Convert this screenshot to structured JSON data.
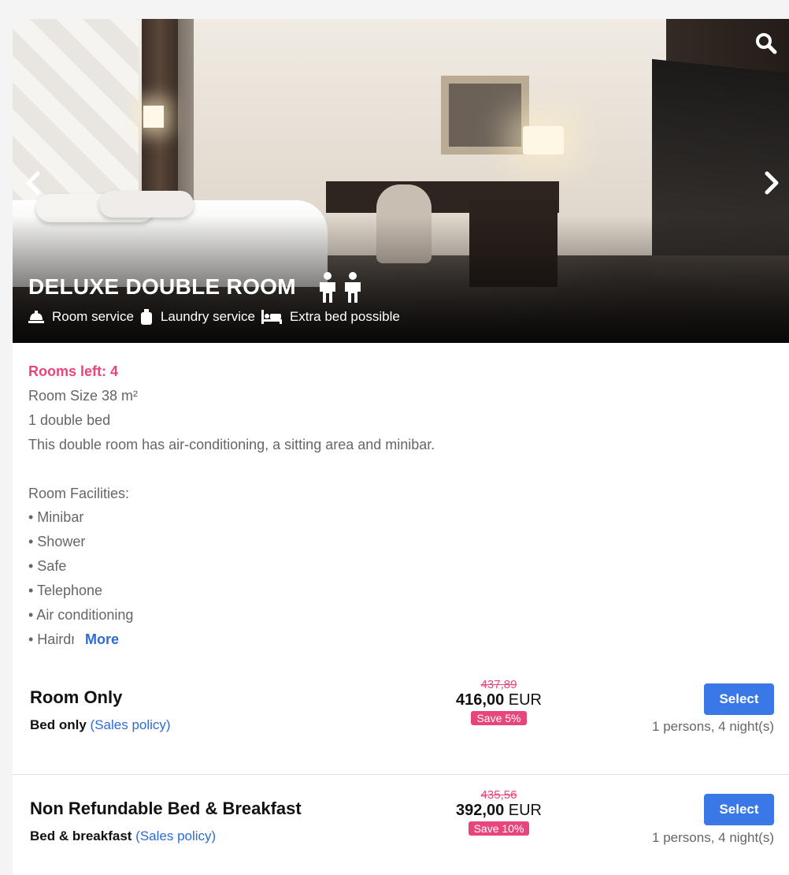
{
  "room": {
    "title": "DELUXE DOUBLE ROOM",
    "guest_icons": [
      "person-icon",
      "person-icon"
    ],
    "amenities": [
      {
        "icon": "bell-icon",
        "label": "Room service"
      },
      {
        "icon": "laundry-icon",
        "label": "Laundry service"
      },
      {
        "icon": "bed-icon",
        "label": "Extra bed possible"
      }
    ],
    "gallery_icons": {
      "search": "search-icon",
      "prev": "chevron-left-icon",
      "next": "chevron-right-icon"
    }
  },
  "details": {
    "rooms_left": "Rooms left: 4",
    "size": "Room Size 38 m²",
    "beds": "1 double bed",
    "description": "This double room has air-conditioning, a sitting area and minibar.",
    "facilities_heading": "Room Facilities:",
    "facilities": [
      "• Minibar",
      "• Shower",
      "• Safe",
      "• Telephone",
      "• Air conditioning"
    ],
    "truncated_item": "• Hairdryer",
    "more_label": "More"
  },
  "rates": [
    {
      "name": "Room Only",
      "board": "Bed only",
      "policy_label": "(Sales policy)",
      "old_price": "437,89",
      "price": "416,00",
      "currency": "EUR",
      "save": "Save 5%",
      "select_label": "Select",
      "stay": "1 persons, 4 night(s)"
    },
    {
      "name": "Non Refundable Bed & Breakfast",
      "board": "Bed & breakfast",
      "policy_label": "(Sales policy)",
      "old_price": "435,56",
      "price": "392,00",
      "currency": "EUR",
      "save": "Save 10%",
      "select_label": "Select",
      "stay": "1 persons, 4 night(s)"
    }
  ],
  "colors": {
    "accent": "#3b78e7",
    "highlight": "#e8457c",
    "link": "#2e6bd6"
  }
}
